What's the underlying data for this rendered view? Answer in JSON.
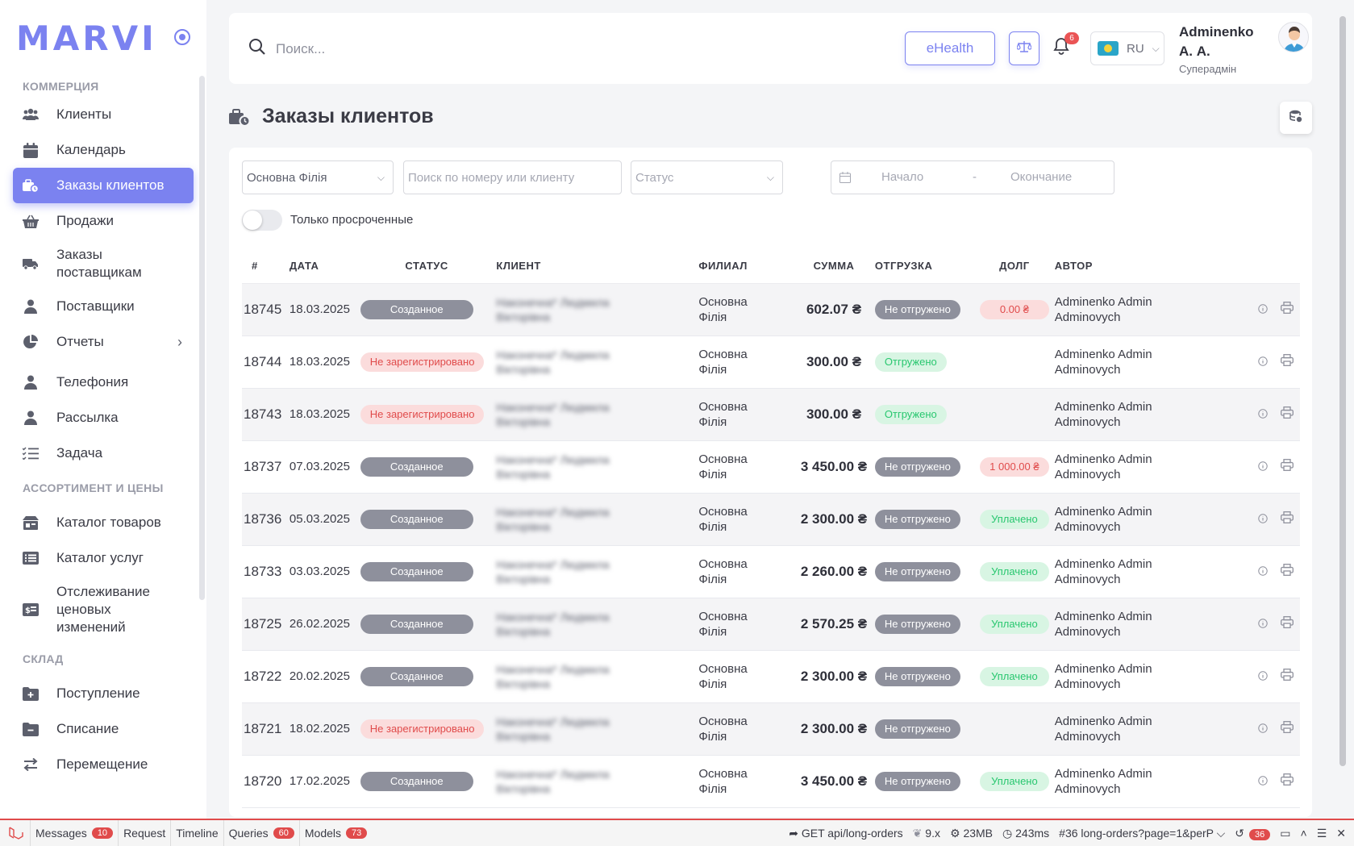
{
  "app": {
    "logo": "MARVI"
  },
  "sidebar": {
    "sections": [
      {
        "title": "КОММЕРЦИЯ"
      },
      {
        "title": "АССОРТИМЕНТ И ЦЕНЫ"
      },
      {
        "title": "СКЛАД"
      }
    ],
    "items": [
      {
        "label": "Клиенты",
        "icon": "users-icon"
      },
      {
        "label": "Календарь",
        "icon": "calendar-icon"
      },
      {
        "label": "Заказы клиентов",
        "icon": "orders-icon"
      },
      {
        "label": "Продажи",
        "icon": "basket-icon"
      },
      {
        "label": "Заказы поставщикам",
        "icon": "truck-icon"
      },
      {
        "label": "Поставщики",
        "icon": "user-icon"
      },
      {
        "label": "Отчеты",
        "icon": "pie-chart-icon"
      },
      {
        "label": "Телефония",
        "icon": "user-icon"
      },
      {
        "label": "Рассылка",
        "icon": "user-icon"
      },
      {
        "label": "Задача",
        "icon": "checklist-icon"
      },
      {
        "label": "Каталог товаров",
        "icon": "catalog-icon"
      },
      {
        "label": "Каталог услуг",
        "icon": "list-icon"
      },
      {
        "label": "Отслеживание ценовых изменений",
        "icon": "price-icon"
      },
      {
        "label": "Поступление",
        "icon": "folder-plus-icon"
      },
      {
        "label": "Списание",
        "icon": "folder-minus-icon"
      },
      {
        "label": "Перемещение",
        "icon": "transfer-icon"
      }
    ]
  },
  "header": {
    "search_placeholder": "Поиск...",
    "ehealth_label": "eHealth",
    "notifications_count": "6",
    "language": "RU",
    "user_name": "Adminenko А. А.",
    "user_role": "Суперадмін"
  },
  "page": {
    "title": "Заказы клиентов"
  },
  "filters": {
    "branch": "Основна Філія",
    "search_placeholder": "Поиск по номеру или клиенту",
    "status_placeholder": "Статус",
    "date_start": "Начало",
    "date_sep": "-",
    "date_end": "Окончание",
    "overdue_label": "Только просроченные"
  },
  "table": {
    "columns": [
      "#",
      "ДАТА",
      "СТАТУС",
      "КЛИЕНТ",
      "ФИЛИАЛ",
      "СУММА",
      "ОТГРУЗКА",
      "ДОЛГ",
      "АВТОР"
    ],
    "rows": [
      {
        "id": "18745",
        "date": "18.03.2025",
        "status": "Созданное",
        "status_type": "created",
        "client": "Наконечна* Людмила Вікторівна",
        "branch": "Основна Філія",
        "sum": "602.07 ₴",
        "shipment": "Не отгружено",
        "shipment_type": "not",
        "debt": "0.00 ₴",
        "debt_type": "debt",
        "author": "Adminenko Admin Adminovych"
      },
      {
        "id": "18744",
        "date": "18.03.2025",
        "status": "Не зарегистрировано",
        "status_type": "unreg",
        "client": "Наконечна* Людмила Вікторівна",
        "branch": "Основна Філія",
        "sum": "300.00 ₴",
        "shipment": "Отгружено",
        "shipment_type": "shipped",
        "debt": "",
        "debt_type": "none",
        "author": "Adminenko Admin Adminovych"
      },
      {
        "id": "18743",
        "date": "18.03.2025",
        "status": "Не зарегистрировано",
        "status_type": "unreg",
        "client": "Наконечна* Людмила Вікторівна",
        "branch": "Основна Філія",
        "sum": "300.00 ₴",
        "shipment": "Отгружено",
        "shipment_type": "shipped",
        "debt": "",
        "debt_type": "none",
        "author": "Adminenko Admin Adminovych"
      },
      {
        "id": "18737",
        "date": "07.03.2025",
        "status": "Созданное",
        "status_type": "created",
        "client": "Наконечна* Людмила Вікторівна",
        "branch": "Основна Філія",
        "sum": "3 450.00 ₴",
        "shipment": "Не отгружено",
        "shipment_type": "not",
        "debt": "1 000.00 ₴",
        "debt_type": "debt",
        "author": "Adminenko Admin Adminovych"
      },
      {
        "id": "18736",
        "date": "05.03.2025",
        "status": "Созданное",
        "status_type": "created",
        "client": "Наконечна* Людмила Вікторівна",
        "branch": "Основна Філія",
        "sum": "2 300.00 ₴",
        "shipment": "Не отгружено",
        "shipment_type": "not",
        "debt": "Уплачено",
        "debt_type": "paid",
        "author": "Adminenko Admin Adminovych"
      },
      {
        "id": "18733",
        "date": "03.03.2025",
        "status": "Созданное",
        "status_type": "created",
        "client": "Наконечна* Людмила Вікторівна",
        "branch": "Основна Філія",
        "sum": "2 260.00 ₴",
        "shipment": "Не отгружено",
        "shipment_type": "not",
        "debt": "Уплачено",
        "debt_type": "paid",
        "author": "Adminenko Admin Adminovych"
      },
      {
        "id": "18725",
        "date": "26.02.2025",
        "status": "Созданное",
        "status_type": "created",
        "client": "Наконечна* Людмила Вікторівна",
        "branch": "Основна Філія",
        "sum": "2 570.25 ₴",
        "shipment": "Не отгружено",
        "shipment_type": "not",
        "debt": "Уплачено",
        "debt_type": "paid",
        "author": "Adminenko Admin Adminovych"
      },
      {
        "id": "18722",
        "date": "20.02.2025",
        "status": "Созданное",
        "status_type": "created",
        "client": "Наконечна* Людмила Вікторівна",
        "branch": "Основна Філія",
        "sum": "2 300.00 ₴",
        "shipment": "Не отгружено",
        "shipment_type": "not",
        "debt": "Уплачено",
        "debt_type": "paid",
        "author": "Adminenko Admin Adminovych"
      },
      {
        "id": "18721",
        "date": "18.02.2025",
        "status": "Не зарегистрировано",
        "status_type": "unreg",
        "client": "Наконечна* Людмила Вікторівна",
        "branch": "Основна Філія",
        "sum": "2 300.00 ₴",
        "shipment": "Не отгружено",
        "shipment_type": "not",
        "debt": "",
        "debt_type": "none",
        "author": "Adminenko Admin Adminovych"
      },
      {
        "id": "18720",
        "date": "17.02.2025",
        "status": "Созданное",
        "status_type": "created",
        "client": "Наконечна* Людмила Вікторівна",
        "branch": "Основна Філія",
        "sum": "3 450.00 ₴",
        "shipment": "Не отгружено",
        "shipment_type": "not",
        "debt": "Уплачено",
        "debt_type": "paid",
        "author": "Adminenko Admin Adminovych"
      }
    ]
  },
  "debugbar": {
    "messages_label": "Messages",
    "messages_count": "10",
    "request_label": "Request",
    "timeline_label": "Timeline",
    "queries_label": "Queries",
    "queries_count": "60",
    "models_label": "Models",
    "models_count": "73",
    "route": "GET api/long-orders",
    "version": "9.x",
    "memory": "23MB",
    "time": "243ms",
    "request_id": "#36 long-orders?page=1&perP",
    "history_count": "36"
  },
  "colors": {
    "accent": "#7b82f0",
    "danger": "#e04b4b",
    "success": "#28c76f",
    "muted": "#8e909c"
  }
}
